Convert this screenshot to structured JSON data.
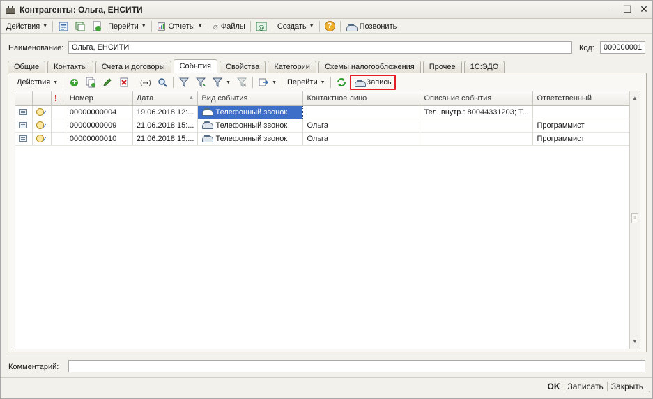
{
  "window": {
    "title": "Контрагенты: Ольга, ЕНСИТИ",
    "minimize": "–",
    "maximize": "☐",
    "close": "✕"
  },
  "toolbar": {
    "actions": "Действия",
    "goto": "Перейти",
    "reports": "Отчеты",
    "files": "Файлы",
    "create": "Создать",
    "help": "?",
    "call": "Позвонить"
  },
  "form": {
    "name_label": "Наименование:",
    "name_value": "Ольга, ЕНСИТИ",
    "code_label": "Код:",
    "code_value": "000000001",
    "comment_label": "Комментарий:",
    "comment_value": ""
  },
  "tabs": [
    {
      "label": "Общие"
    },
    {
      "label": "Контакты"
    },
    {
      "label": "Счета и договоры"
    },
    {
      "label": "События"
    },
    {
      "label": "Свойства"
    },
    {
      "label": "Категории"
    },
    {
      "label": "Схемы налогообложения"
    },
    {
      "label": "Прочее"
    },
    {
      "label": "1С:ЭДО"
    }
  ],
  "active_tab": "События",
  "subtoolbar": {
    "actions": "Действия",
    "goto": "Перейти",
    "record": "Запись"
  },
  "table": {
    "columns": {
      "important": "!",
      "number": "Номер",
      "date": "Дата",
      "event_type": "Вид события",
      "contact": "Контактное лицо",
      "description": "Описание события",
      "responsible": "Ответственный"
    },
    "rows": [
      {
        "number": "00000000004",
        "date": "19.06.2018 12:...",
        "event_type": "Телефонный звонок",
        "contact": "",
        "description": "Тел. внутр.: 80044331203; Т...",
        "responsible": ""
      },
      {
        "number": "00000000009",
        "date": "21.06.2018 15:...",
        "event_type": "Телефонный звонок",
        "contact": "Ольга",
        "description": "",
        "responsible": "Программист"
      },
      {
        "number": "00000000010",
        "date": "21.06.2018 15:...",
        "event_type": "Телефонный звонок",
        "contact": "Ольга",
        "description": "",
        "responsible": "Программист"
      }
    ]
  },
  "footer": {
    "ok": "OK",
    "save": "Записать",
    "close": "Закрыть"
  },
  "colors": {
    "selection": "#3d6ec8",
    "highlight_border": "#e31e24"
  }
}
